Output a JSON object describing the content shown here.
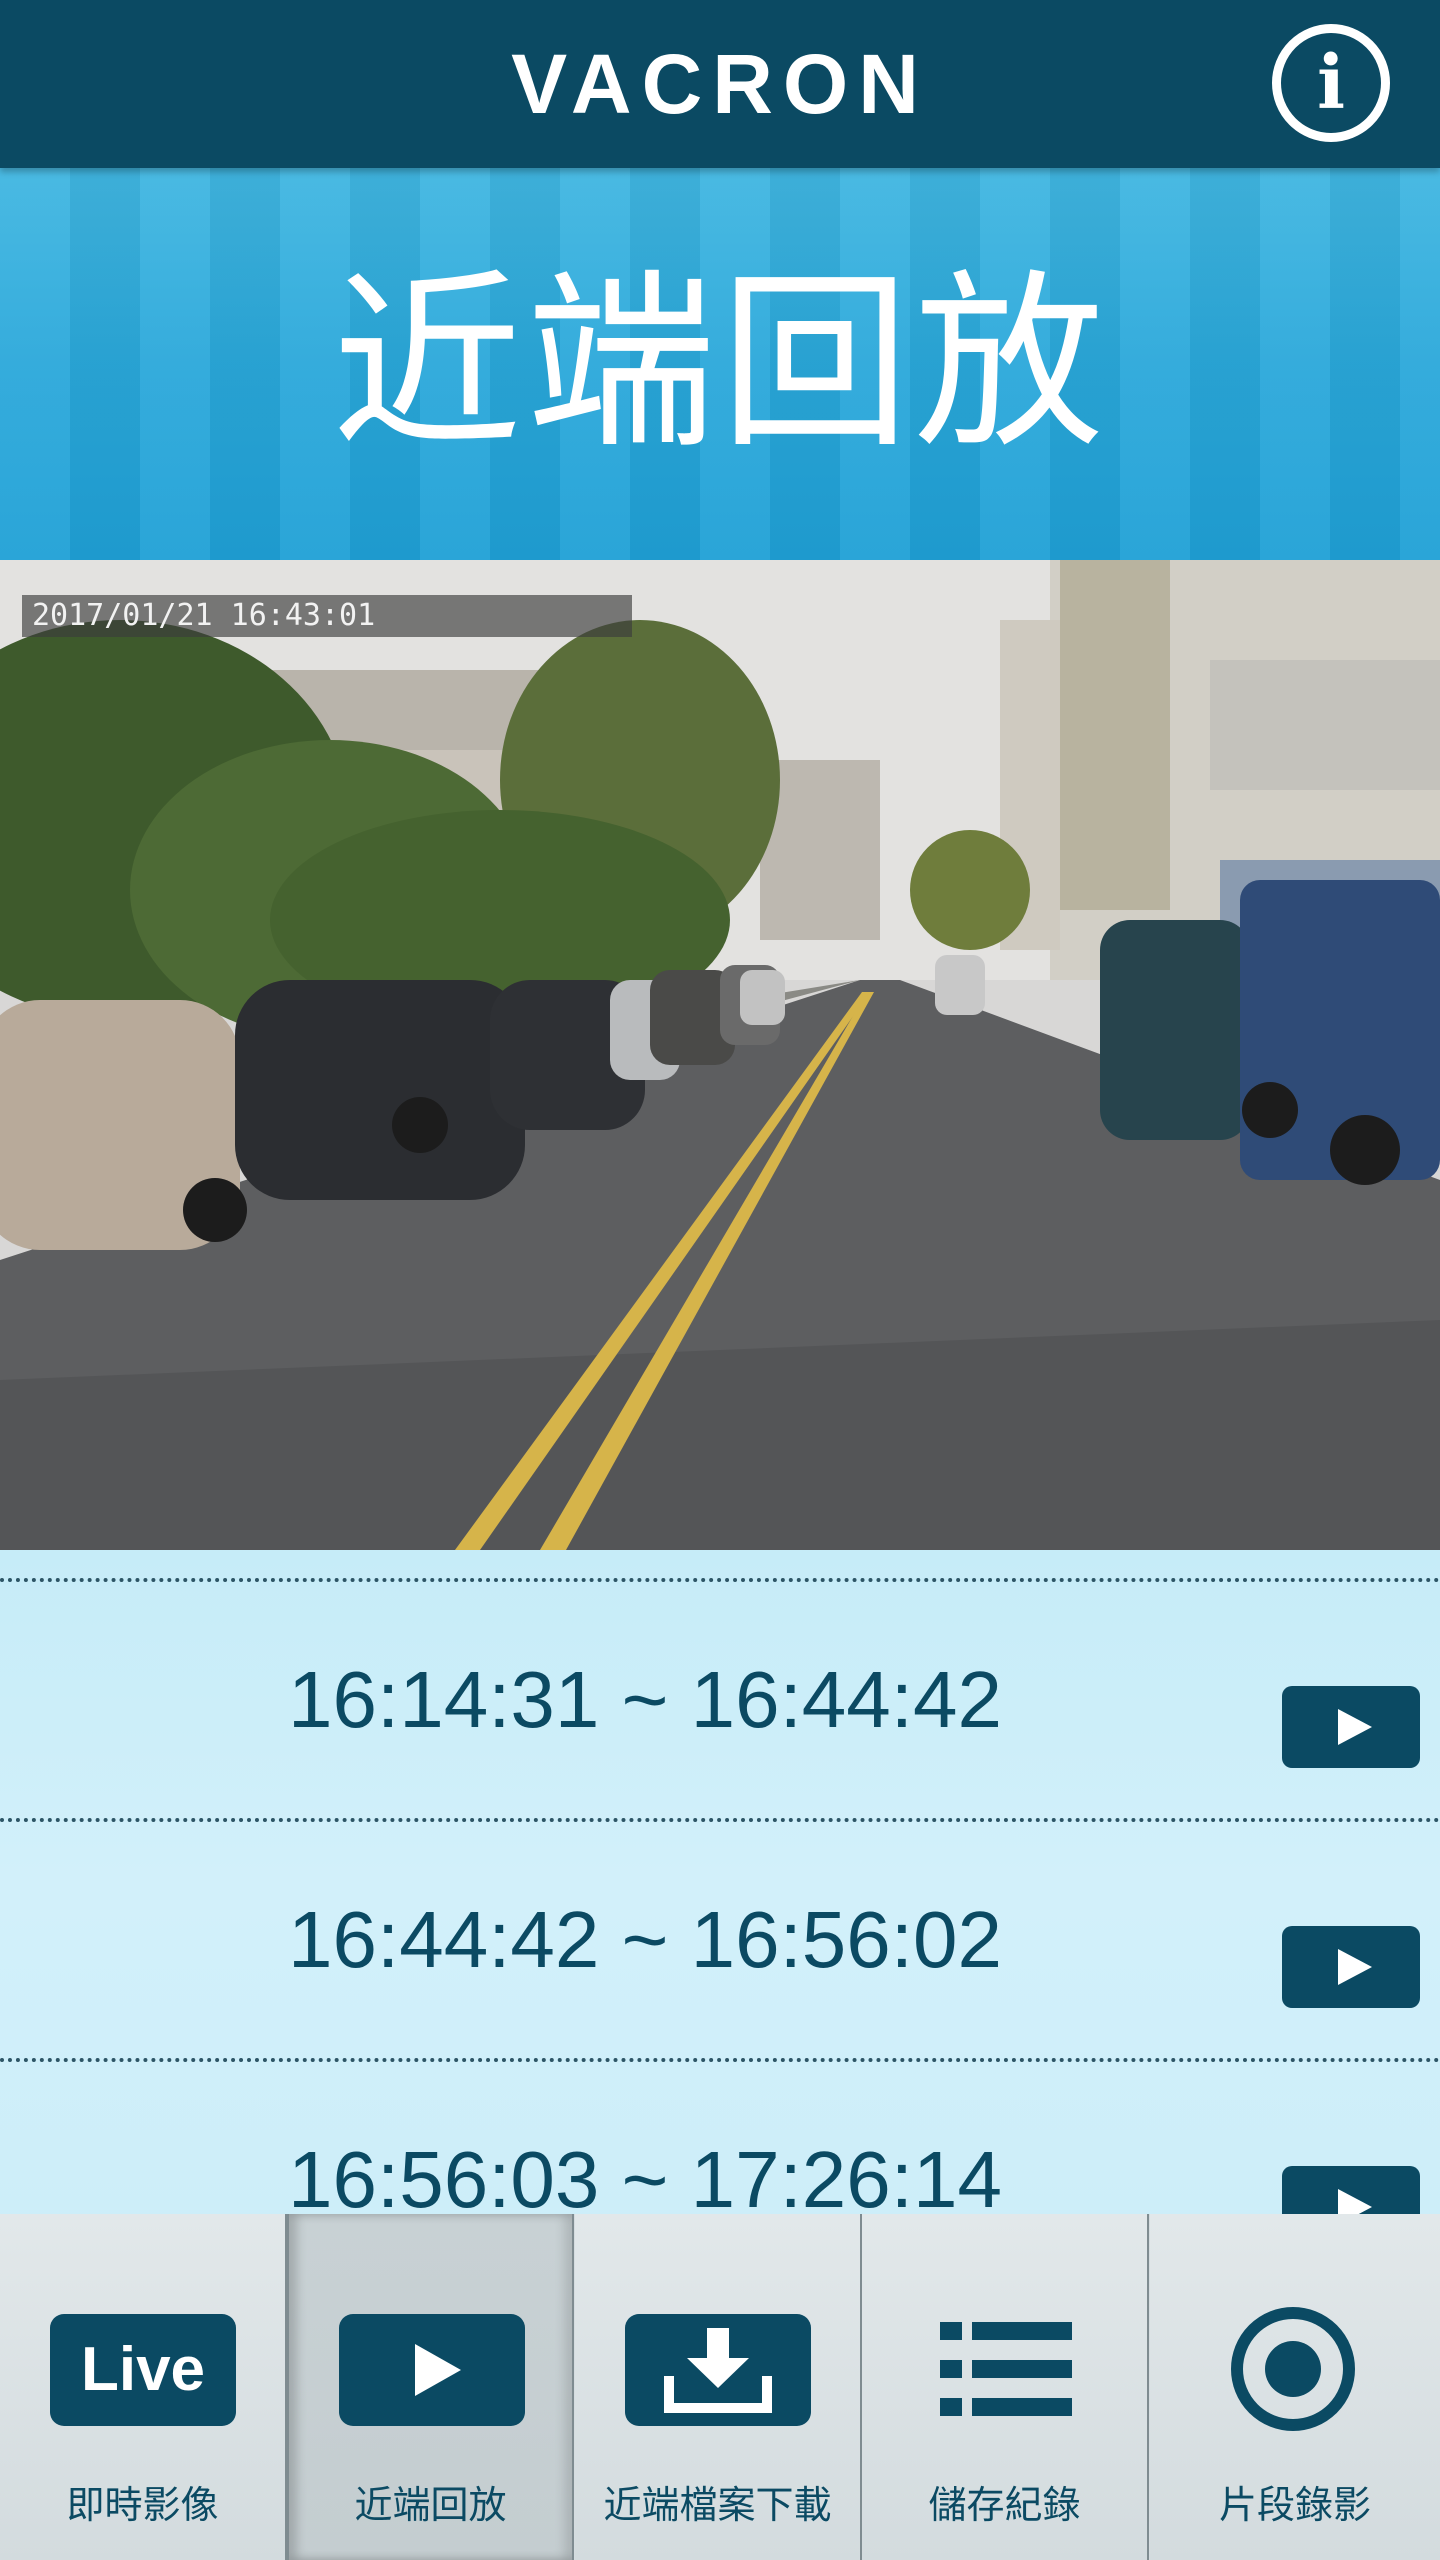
{
  "header": {
    "logo_text": "VACRON",
    "info_icon": "info-icon"
  },
  "banner": {
    "title": "近端回放"
  },
  "video": {
    "timestamp": "2017/01/21  16:43:01"
  },
  "playback_list": {
    "items": [
      {
        "range": "16:14:31 ~ 16:44:42",
        "action_icon": "play-icon"
      },
      {
        "range": "16:44:42 ~ 16:56:02",
        "action_icon": "play-icon"
      },
      {
        "range": "16:56:03 ~ 17:26:14",
        "action_icon": "play-icon"
      }
    ]
  },
  "bottom_nav": {
    "items": [
      {
        "label": "即時影像",
        "icon": "live-icon",
        "icon_text": "Live",
        "active": false
      },
      {
        "label": "近端回放",
        "icon": "play-icon",
        "active": true
      },
      {
        "label": "近端檔案下載",
        "icon": "download-icon",
        "active": false
      },
      {
        "label": "儲存紀錄",
        "icon": "list-icon",
        "active": false
      },
      {
        "label": "片段錄影",
        "icon": "record-icon",
        "active": false
      }
    ]
  },
  "colors": {
    "primary": "#0b4a63",
    "banner": "#2aa8da",
    "list_bg": "#cdeef9",
    "nav_bg": "#d5dde0"
  }
}
